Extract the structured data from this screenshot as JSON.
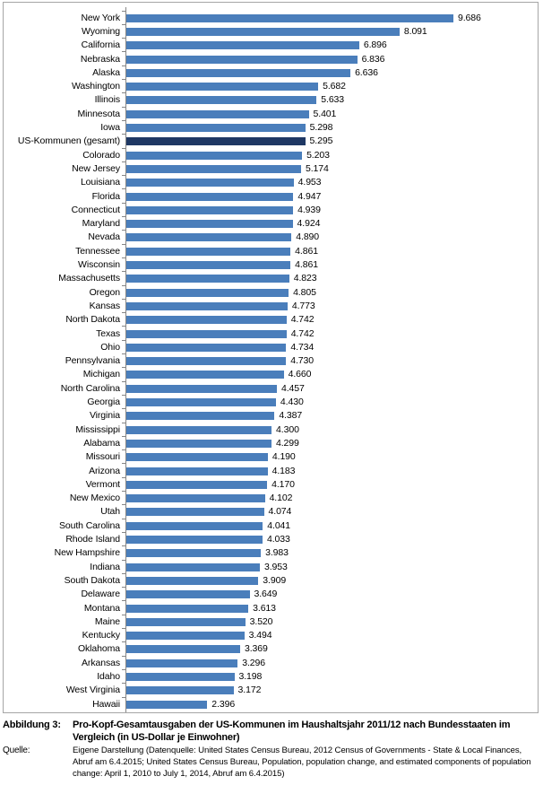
{
  "figure": {
    "label_prefix": "Abbildung 3:",
    "title": "Pro-Kopf-Gesamtausgaben der US-Kommunen im Haushaltsjahr 2011/12 nach Bundesstaaten im Vergleich (in US-Dollar je Einwohner)",
    "source_prefix": "Quelle:",
    "source_text": "Eigene Darstellung (Datenquelle: United States Census Bureau, 2012 Census of Governments - State & Local Finances, Abruf am 6.4.2015; United States Census Bureau, Population, population change, and estimated components of population change: April 1, 2010 to July 1, 2014, Abruf am 6.4.2015)"
  },
  "colors": {
    "bar": "#4a7ebb",
    "bar_highlight": "#1f3864",
    "axis": "#868686",
    "frame": "#a6a6a6",
    "text": "#000000"
  },
  "chart_data": {
    "type": "bar",
    "orientation": "horizontal",
    "title": "Pro-Kopf-Gesamtausgaben der US-Kommunen im Haushaltsjahr 2011/12 nach Bundesstaaten im Vergleich (in US-Dollar je Einwohner)",
    "xlabel": "",
    "ylabel": "",
    "xlim": [
      0,
      9.686
    ],
    "grid": false,
    "legend": "none",
    "value_format": "german-decimal-thousands",
    "highlight_category": "US-Kommunen (gesamt)",
    "categories": [
      "New York",
      "Wyoming",
      "California",
      "Nebraska",
      "Alaska",
      "Washington",
      "Illinois",
      "Minnesota",
      "Iowa",
      "US-Kommunen (gesamt)",
      "Colorado",
      "New Jersey",
      "Louisiana",
      "Florida",
      "Connecticut",
      "Maryland",
      "Nevada",
      "Tennessee",
      "Wisconsin",
      "Massachusetts",
      "Oregon",
      "Kansas",
      "North Dakota",
      "Texas",
      "Ohio",
      "Pennsylvania",
      "Michigan",
      "North Carolina",
      "Georgia",
      "Virginia",
      "Mississippi",
      "Alabama",
      "Missouri",
      "Arizona",
      "Vermont",
      "New Mexico",
      "Utah",
      "South Carolina",
      "Rhode Island",
      "New Hampshire",
      "Indiana",
      "South Dakota",
      "Delaware",
      "Montana",
      "Maine",
      "Kentucky",
      "Oklahoma",
      "Arkansas",
      "Idaho",
      "West Virginia",
      "Hawaii"
    ],
    "values": [
      9686,
      8091,
      6896,
      6836,
      6636,
      5682,
      5633,
      5401,
      5298,
      5295,
      5203,
      5174,
      4953,
      4947,
      4939,
      4924,
      4890,
      4861,
      4861,
      4823,
      4805,
      4773,
      4742,
      4742,
      4734,
      4730,
      4660,
      4457,
      4430,
      4387,
      4300,
      4299,
      4190,
      4183,
      4170,
      4102,
      4074,
      4041,
      4033,
      3983,
      3953,
      3909,
      3649,
      3613,
      3520,
      3494,
      3369,
      3296,
      3198,
      3172,
      2396
    ],
    "value_labels": [
      "9.686",
      "8.091",
      "6.896",
      "6.836",
      "6.636",
      "5.682",
      "5.633",
      "5.401",
      "5.298",
      "5.295",
      "5.203",
      "5.174",
      "4.953",
      "4.947",
      "4.939",
      "4.924",
      "4.890",
      "4.861",
      "4.861",
      "4.823",
      "4.805",
      "4.773",
      "4.742",
      "4.742",
      "4.734",
      "4.730",
      "4.660",
      "4.457",
      "4.430",
      "4.387",
      "4.300",
      "4.299",
      "4.190",
      "4.183",
      "4.170",
      "4.102",
      "4.074",
      "4.041",
      "4.033",
      "3.983",
      "3.953",
      "3.909",
      "3.649",
      "3.613",
      "3.520",
      "3.494",
      "3.369",
      "3.296",
      "3.198",
      "3.172",
      "2.396"
    ]
  }
}
